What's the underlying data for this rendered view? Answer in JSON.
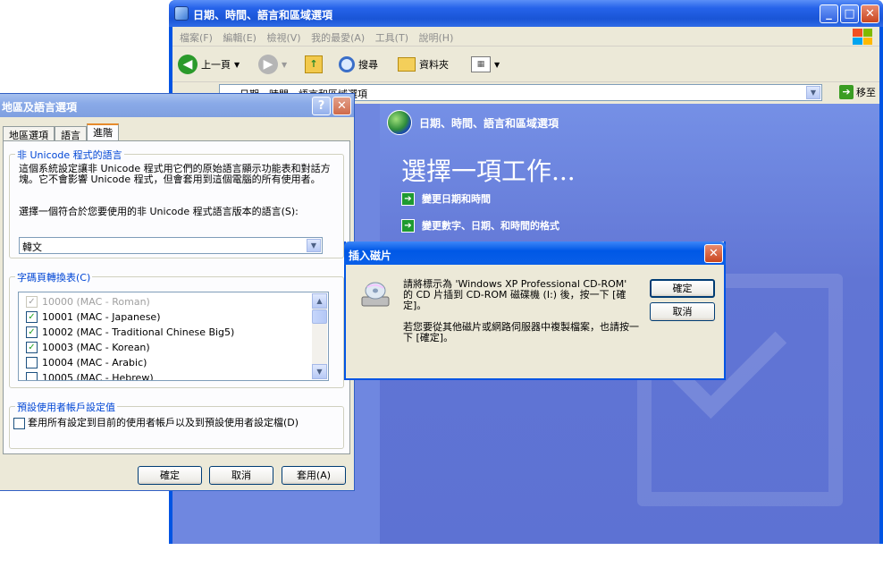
{
  "control_panel": {
    "title": "日期、時間、語言和區域選項",
    "menus": [
      "檔案(F)",
      "編輯(E)",
      "檢視(V)",
      "我的最愛(A)",
      "工具(T)",
      "說明(H)"
    ],
    "toolbar": {
      "back_label": "上一頁",
      "search_label": "搜尋",
      "folders_label": "資料夾"
    },
    "address": {
      "value": "日期、時間、語言和區域選項",
      "go_label": "移至"
    },
    "header": "日期、時間、語言和區域選項",
    "task_title": "選擇一項工作...",
    "tasks": [
      "變更日期和時間",
      "變更數字、日期、和時間的格式"
    ]
  },
  "regional_dialog": {
    "title": "地區及語言選項",
    "tabs": [
      "地區選項",
      "語言",
      "進階"
    ],
    "non_unicode": {
      "legend": "非 Unicode 程式的語言",
      "description": "這個系統設定讓非 Unicode 程式用它們的原始語言顯示功能表和對話方塊。它不會影響 Unicode 程式，但會套用到這個電腦的所有使用者。",
      "prompt": "選擇一個符合於您要使用的非 Unicode 程式語言版本的語言(S):",
      "selected_language": "韓文"
    },
    "codepages": {
      "legend": "字碼頁轉換表(C)",
      "items": [
        {
          "label": "10000 (MAC - Roman)",
          "checked": true,
          "disabled": true
        },
        {
          "label": "10001 (MAC - Japanese)",
          "checked": true,
          "disabled": false
        },
        {
          "label": "10002 (MAC - Traditional Chinese Big5)",
          "checked": true,
          "disabled": false
        },
        {
          "label": "10003 (MAC - Korean)",
          "checked": true,
          "disabled": false
        },
        {
          "label": "10004 (MAC - Arabic)",
          "checked": false,
          "disabled": false
        },
        {
          "label": "10005 (MAC - Hebrew)",
          "checked": false,
          "disabled": false
        }
      ]
    },
    "default_account": {
      "legend": "預設使用者帳戶設定值",
      "checkbox_label": "套用所有設定到目前的使用者帳戶以及到預設使用者設定檔(D)"
    },
    "buttons": {
      "ok": "確定",
      "cancel": "取消",
      "apply": "套用(A)"
    }
  },
  "disk_dialog": {
    "title": "插入磁片",
    "message1": "請將標示為 'Windows XP Professional CD-ROM' 的 CD 片插到 CD-ROM 磁碟機 (I:) 後，按一下 [確定]。",
    "message2": "若您要從其他磁片或網路伺服器中複製檔案，也請按一下 [確定]。",
    "ok_label": "確定",
    "cancel_label": "取消"
  }
}
